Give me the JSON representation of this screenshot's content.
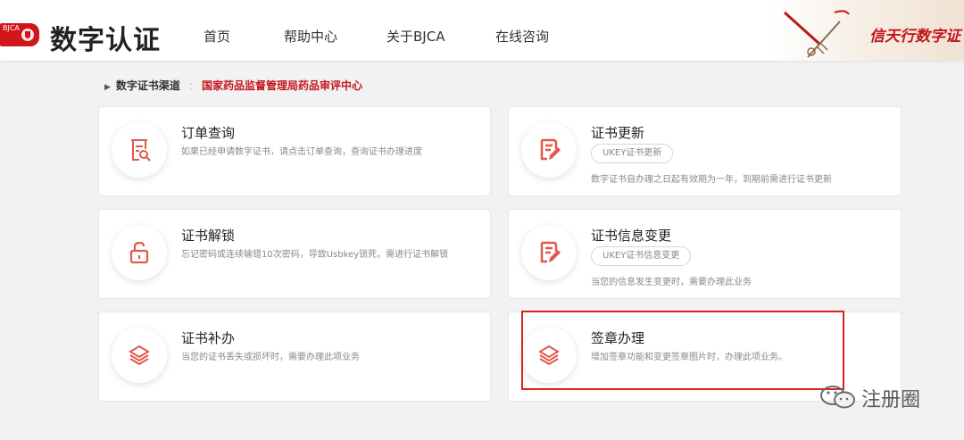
{
  "header": {
    "logo_badge": "BJCA",
    "logo_text": "数字认证",
    "nav": [
      "首页",
      "帮助中心",
      "关于BJCA",
      "在线咨询"
    ],
    "brand_slogan": "信天行数字证"
  },
  "breadcrumb": {
    "link": "数字证书渠道",
    "separator": ":",
    "current": "国家药品监督管理局药品审评中心"
  },
  "cards": [
    {
      "title": "订单查询",
      "desc": "如果已经申请数字证书，请点击订单查询，查询证书办理进度",
      "icon": "order-search-icon"
    },
    {
      "title": "证书更新",
      "tag": "UKEY证书更新",
      "desc": "数字证书自办理之日起有效期为一年，到期前需进行证书更新",
      "icon": "edit-doc-icon"
    },
    {
      "title": "证书解锁",
      "desc": "忘记密码或连续输错10次密码，导致Usbkey锁死，需进行证书解锁",
      "icon": "unlock-icon"
    },
    {
      "title": "证书信息变更",
      "tag": "UKEY证书信息变更",
      "desc": "当您的信息发生变更时，需要办理此业务",
      "icon": "edit-doc-icon"
    },
    {
      "title": "证书补办",
      "desc": "当您的证书丢失或损坏时，需要办理此项业务",
      "icon": "layers-icon"
    },
    {
      "title": "签章办理",
      "desc": "增加签章功能和变更签章图片时，办理此项业务。",
      "icon": "layers-icon"
    }
  ],
  "watermark": "注册圈",
  "colors": {
    "accent": "#c4151c",
    "icon": "#e0594a",
    "highlight": "#d9251c"
  }
}
